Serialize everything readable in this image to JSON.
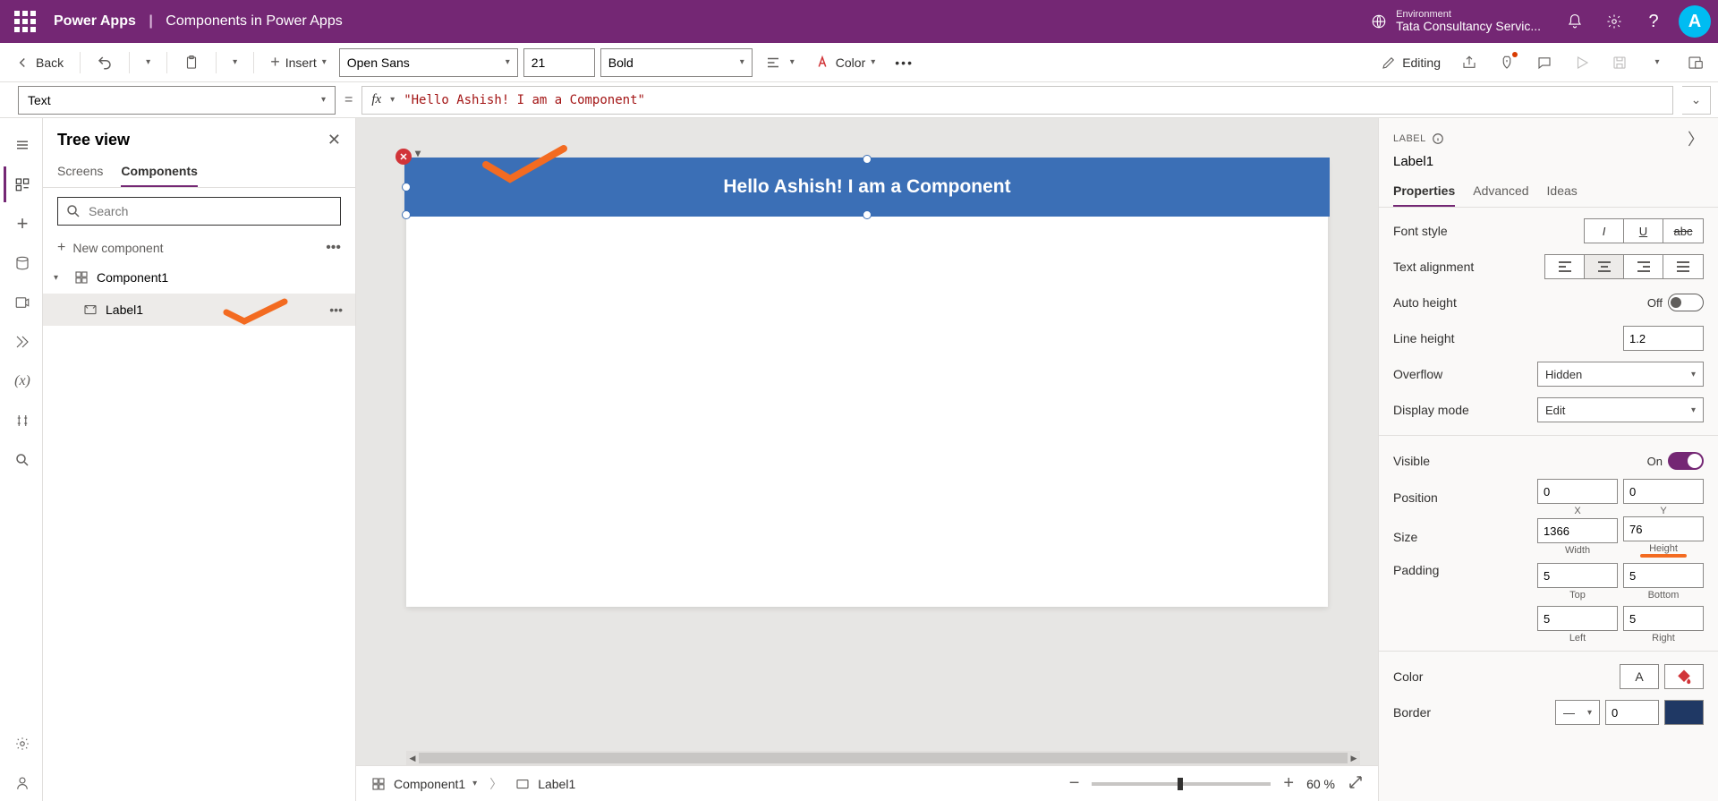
{
  "header": {
    "app": "Power Apps",
    "doc": "Components in Power Apps",
    "env_label": "Environment",
    "env_name": "Tata Consultancy Servic...",
    "avatar_letter": "A"
  },
  "ribbon": {
    "back": "Back",
    "insert": "Insert",
    "font": "Open Sans",
    "font_size": "21",
    "font_weight": "Bold",
    "color": "Color",
    "editing": "Editing"
  },
  "formula": {
    "property": "Text",
    "value": "\"Hello Ashish! I am a Component\""
  },
  "treeview": {
    "title": "Tree view",
    "tabs": {
      "screens": "Screens",
      "components": "Components"
    },
    "search_placeholder": "Search",
    "new_component": "New component",
    "component_name": "Component1",
    "label_name": "Label1"
  },
  "canvas": {
    "label_text": "Hello Ashish! I am a Component",
    "footer": {
      "component": "Component1",
      "label": "Label1",
      "zoom": "60",
      "zoom_unit": "%"
    }
  },
  "props": {
    "type_tag": "LABEL",
    "name": "Label1",
    "tabs": {
      "properties": "Properties",
      "advanced": "Advanced",
      "ideas": "Ideas"
    },
    "font_style": "Font style",
    "text_alignment": "Text alignment",
    "auto_height": {
      "label": "Auto height",
      "value": "Off"
    },
    "line_height": {
      "label": "Line height",
      "value": "1.2"
    },
    "overflow": {
      "label": "Overflow",
      "value": "Hidden"
    },
    "display_mode": {
      "label": "Display mode",
      "value": "Edit"
    },
    "visible": {
      "label": "Visible",
      "value": "On"
    },
    "position": {
      "label": "Position",
      "x": "0",
      "y": "0",
      "xl": "X",
      "yl": "Y"
    },
    "size": {
      "label": "Size",
      "w": "1366",
      "h": "76",
      "wl": "Width",
      "hl": "Height"
    },
    "padding": {
      "label": "Padding",
      "t": "5",
      "b": "5",
      "l": "5",
      "r": "5",
      "tl": "Top",
      "bl": "Bottom",
      "ll": "Left",
      "rl": "Right"
    },
    "color": {
      "label": "Color",
      "sample": "A"
    },
    "border": {
      "label": "Border",
      "value": "0"
    }
  }
}
